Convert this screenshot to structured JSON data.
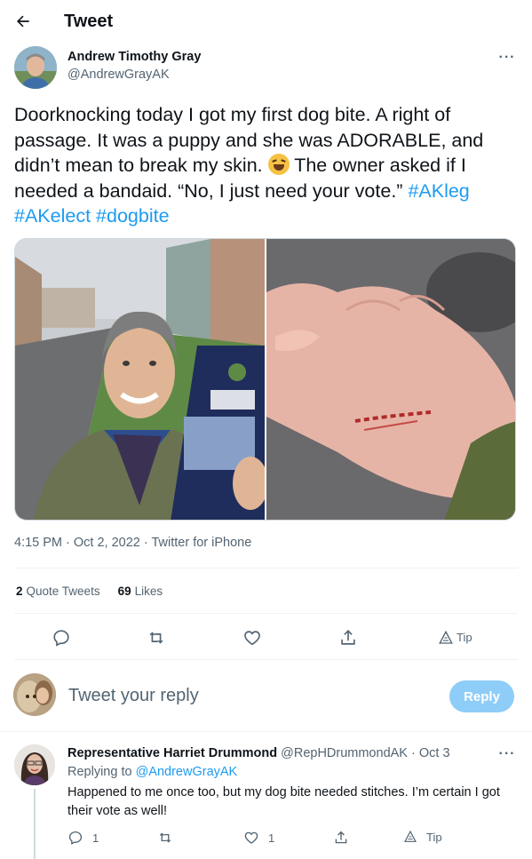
{
  "header": {
    "title": "Tweet",
    "back_icon": "arrow-left-icon"
  },
  "tweet": {
    "author_name": "Andrew Timothy Gray",
    "author_handle": "@AndrewGrayAK",
    "text_main": "Doorknocking today I got my first dog bite. A right of passage. It was a puppy and she was ADORABLE, and didn’t mean to break my skin. ",
    "text_after_emoji": " The owner asked if I needed a bandaid. “No, I just need your vote.” ",
    "hashtags": [
      "#AKleg",
      "#AKelect",
      "#dogbite"
    ],
    "meta": "4:15 PM · Oct 2, 2022 · Twitter for iPhone",
    "stats": {
      "quote_count": "2",
      "quote_label": "Quote Tweets",
      "likes_count": "69",
      "likes_label": "Likes"
    },
    "actions": {
      "tip_label": "Tip"
    }
  },
  "compose": {
    "placeholder": "Tweet your reply",
    "button_label": "Reply"
  },
  "reply": {
    "author_name": "Representative Harriet Drummond",
    "author_handle": "@RepHDrummondAK",
    "time": "· Oct 3",
    "replying_label": "Replying to",
    "replying_to": "@AndrewGrayAK",
    "text": "Happened to me once too, but my dog bite needed stitches. I’m certain I got their vote as well!",
    "reply_count": "1",
    "like_count": "1",
    "tip_label": "Tip"
  },
  "colors": {
    "accent": "#1d9bf0",
    "secondary_text": "#536471",
    "reply_button_disabled": "#8ecdf8"
  }
}
